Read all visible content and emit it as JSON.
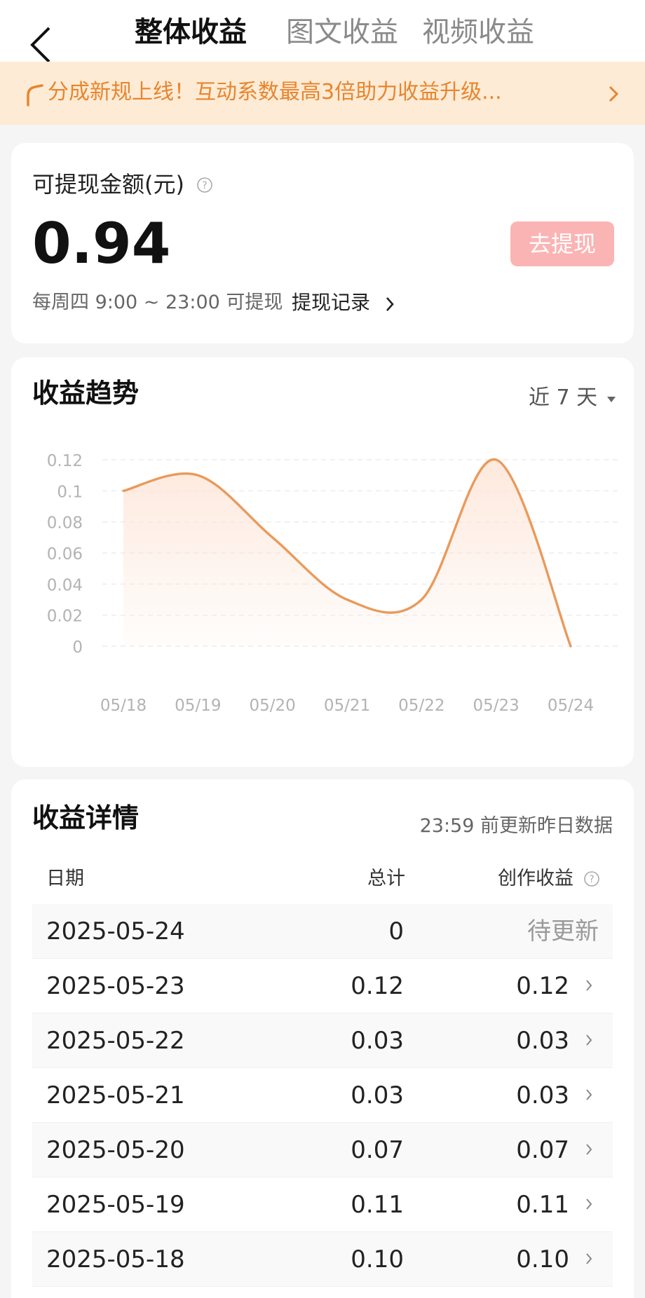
{
  "header": {
    "tabs": [
      {
        "label": "整体收益",
        "active": true
      },
      {
        "label": "图文收益",
        "active": false
      },
      {
        "label": "视频收益",
        "active": false
      }
    ],
    "back_icon": "chevron-left-icon"
  },
  "banner": {
    "text": "分成新规上线！互动系数最高3倍助力收益升级...",
    "icon": "horn-icon",
    "color": "#e8852d",
    "background": "#fdebd6"
  },
  "balance": {
    "label": "可提现金额(元)",
    "amount": "0.94",
    "withdraw_label": "去提现",
    "schedule": "每周四 9:00 ~ 23:00 可提现",
    "record_label": "提现记录"
  },
  "trend": {
    "title": "收益趋势",
    "range_label": "近 7 天"
  },
  "chart_data": {
    "type": "area",
    "categories": [
      "05/18",
      "05/19",
      "05/20",
      "05/21",
      "05/22",
      "05/23",
      "05/24"
    ],
    "values": [
      0.1,
      0.11,
      0.07,
      0.03,
      0.03,
      0.12,
      0
    ],
    "yticks": [
      "0.12",
      "0.1",
      "0.08",
      "0.06",
      "0.04",
      "0.02",
      "0"
    ],
    "ylim": [
      0,
      0.12
    ],
    "grid": true,
    "line_color": "#e99a5b",
    "fill_color": "#fde5d7"
  },
  "detail": {
    "title": "收益详情",
    "note": "23:59 前更新昨日数据",
    "columns": [
      "日期",
      "总计",
      "创作收益"
    ],
    "rows": [
      {
        "date": "2025-05-24",
        "total": "0",
        "earn": "待更新",
        "pending": true
      },
      {
        "date": "2025-05-23",
        "total": "0.12",
        "earn": "0.12",
        "pending": false
      },
      {
        "date": "2025-05-22",
        "total": "0.03",
        "earn": "0.03",
        "pending": false
      },
      {
        "date": "2025-05-21",
        "total": "0.03",
        "earn": "0.03",
        "pending": false
      },
      {
        "date": "2025-05-20",
        "total": "0.07",
        "earn": "0.07",
        "pending": false
      },
      {
        "date": "2025-05-19",
        "total": "0.11",
        "earn": "0.11",
        "pending": false
      },
      {
        "date": "2025-05-18",
        "total": "0.10",
        "earn": "0.10",
        "pending": false
      }
    ]
  },
  "colors": {
    "withdraw_button": "#fbb4b4",
    "accent": "#e8852d"
  }
}
